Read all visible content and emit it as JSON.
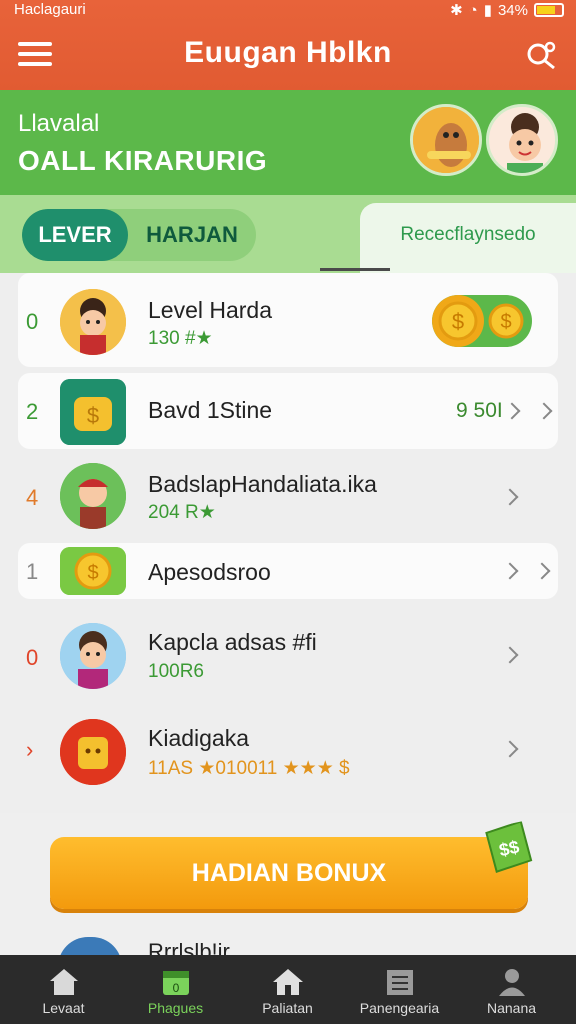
{
  "status_bar": {
    "carrier": "Haclagauri",
    "battery": "34%"
  },
  "app_bar": {
    "title": "Euugan Hblkn"
  },
  "hero": {
    "subtitle": "Llavalal",
    "title": "OALL KIRARURIG"
  },
  "tabs": {
    "active": "LEVER",
    "inactive": "HARJAN",
    "right": "Rececflaynsedo"
  },
  "list": [
    {
      "rank": "0",
      "name": "Level Harda",
      "sub": "130 #★"
    },
    {
      "rank": "2",
      "name": "Bavd 1Stine",
      "score": "9 50I"
    },
    {
      "rank": "4",
      "name": "BadslapHandaliata.ika",
      "sub": "204 R★"
    },
    {
      "rank": "1",
      "name": "Apesodsroo"
    },
    {
      "rank": "0",
      "name": "Kapcla adsas #fi",
      "sub": "100R6"
    },
    {
      "rank": "›",
      "name": "Kiadigaka",
      "sub": "11AS ★010011 ★★★ $"
    }
  ],
  "bonus": {
    "label": "HADIAN BONUX",
    "badge": "$$"
  },
  "peek_row": {
    "name": "Rrrlslb!ir"
  },
  "bottom_nav": [
    {
      "label": "Levaat",
      "icon": "home-icon"
    },
    {
      "label": "Phagues",
      "icon": "calendar-icon",
      "active": true
    },
    {
      "label": "Paliatan",
      "icon": "house-icon"
    },
    {
      "label": "Panengearia",
      "icon": "book-icon"
    },
    {
      "label": "Nanana",
      "icon": "profile-icon"
    }
  ],
  "colors": {
    "header": "#e15b32",
    "hero": "#5cb84a",
    "accent_green": "#1f8f6c",
    "bonus": "#f39a0d",
    "nav": "#2b2b2b"
  }
}
